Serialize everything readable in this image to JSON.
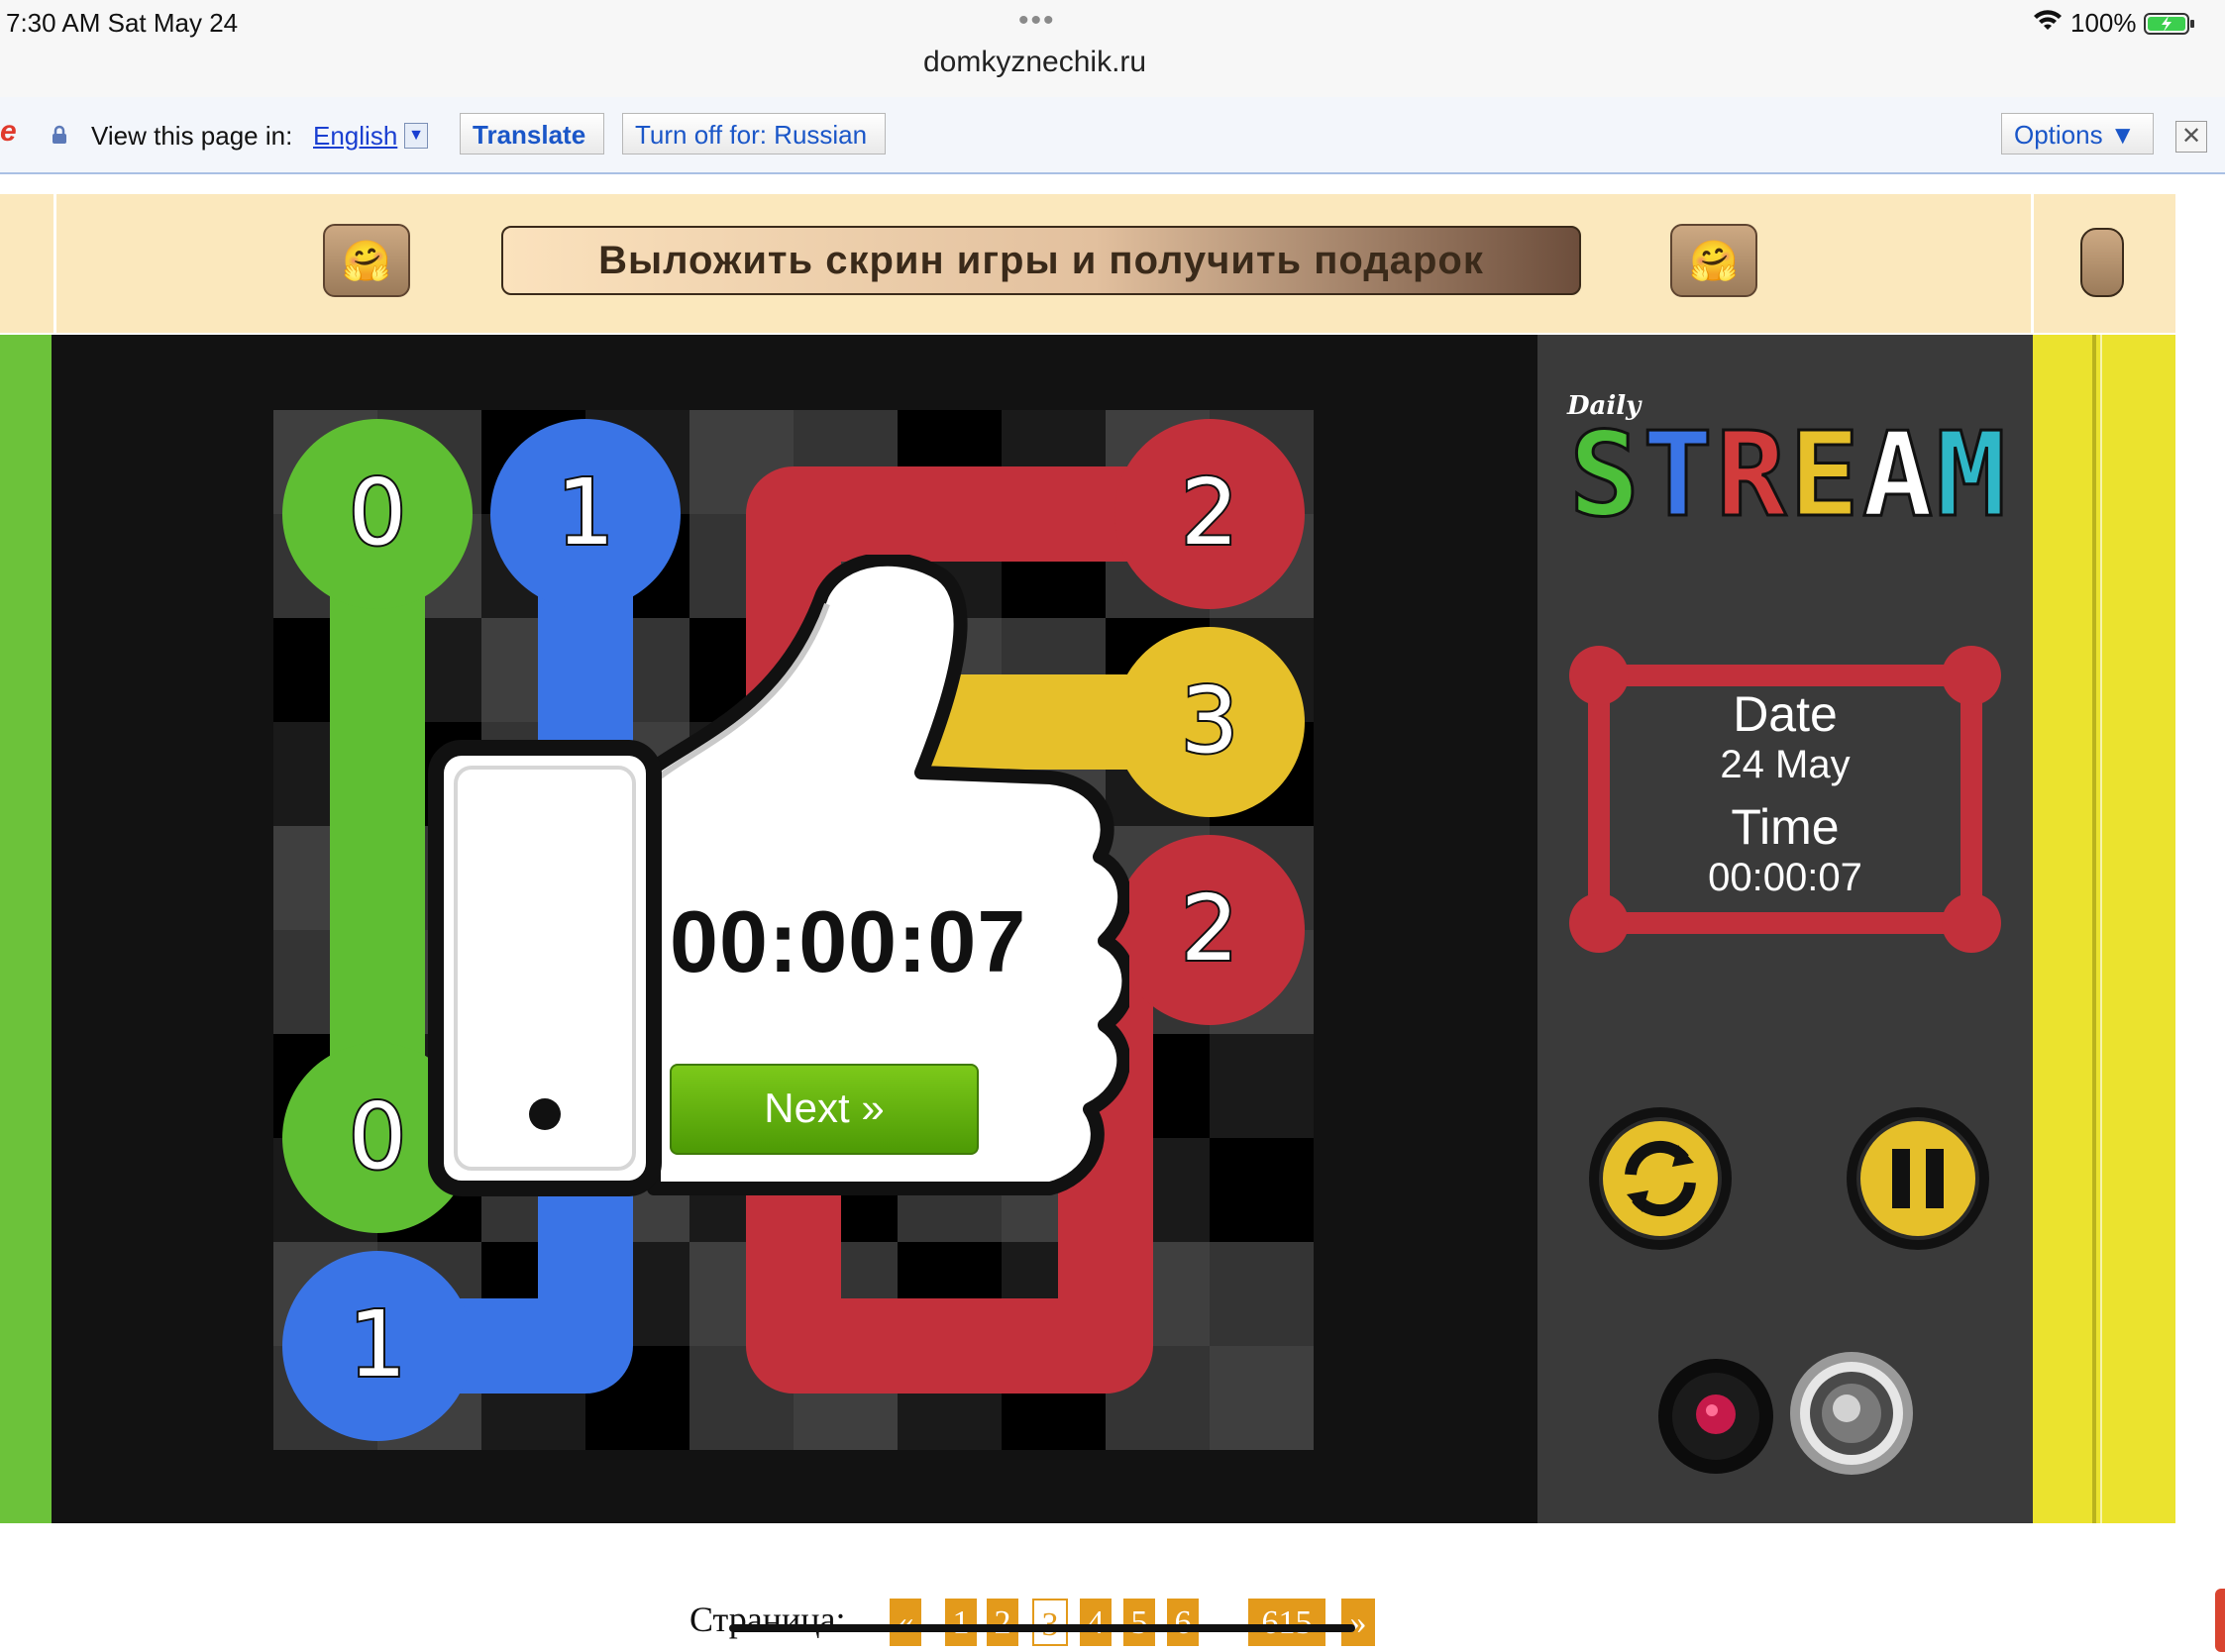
{
  "status_bar": {
    "time": "7:30 AM   Sat May 24",
    "domain": "domkyznechik.ru",
    "battery": "100%"
  },
  "translate_bar": {
    "label": "View this page in:",
    "language": "English",
    "translate_button": "Translate",
    "turn_off_button": "Turn off for: Russian",
    "options_button": "Options ▼",
    "close_symbol": "✕",
    "icons": [
      "lock-icon",
      "close-icon"
    ]
  },
  "banner": {
    "cta": "Выложить скрин игры и получить подарок",
    "emoji": "🤗"
  },
  "board": {
    "grid_size": 5,
    "numbers": [
      {
        "label": "0",
        "color": "#5fbe33",
        "cell": [
          0,
          0
        ]
      },
      {
        "label": "1",
        "color": "#3a74e6",
        "cell": [
          1,
          0
        ]
      },
      {
        "label": "2",
        "color": "#c2303b",
        "cell": [
          4,
          0
        ]
      },
      {
        "label": "3",
        "color": "#e6c02a",
        "cell": [
          4,
          1
        ]
      },
      {
        "label": "2",
        "color": "#c2303b",
        "cell": [
          4,
          2
        ]
      },
      {
        "label": "0",
        "color": "#5fbe33",
        "cell": [
          0,
          3
        ]
      },
      {
        "label": "1",
        "color": "#3a74e6",
        "cell": [
          0,
          4
        ]
      }
    ]
  },
  "sidebar": {
    "logo_small": "Daily",
    "logo_letters": [
      "S",
      "T",
      "R",
      "E",
      "A",
      "M"
    ],
    "logo_colors": [
      "#4dbf3a",
      "#3a74e6",
      "#d13b3b",
      "#e6c02a",
      "#ffffff",
      "#2fb7c7"
    ],
    "date_label": "Date",
    "date_value": "24 May",
    "time_label": "Time",
    "time_value": "00:00:07",
    "frame_color": "#c2303b"
  },
  "overlay": {
    "time": "00:00:07",
    "next_button": "Next »"
  },
  "pagination": {
    "label": "Страница:",
    "prev": "«",
    "pages": [
      "1",
      "2",
      "3",
      "4",
      "5",
      "6"
    ],
    "current": "3",
    "ellipsis": "...",
    "last": "615",
    "next": "»"
  },
  "colors": {
    "green": "#5fbe33",
    "blue": "#3a74e6",
    "red": "#c2303b",
    "yellow": "#e6c02a",
    "page_accent": "#e39a1b"
  }
}
